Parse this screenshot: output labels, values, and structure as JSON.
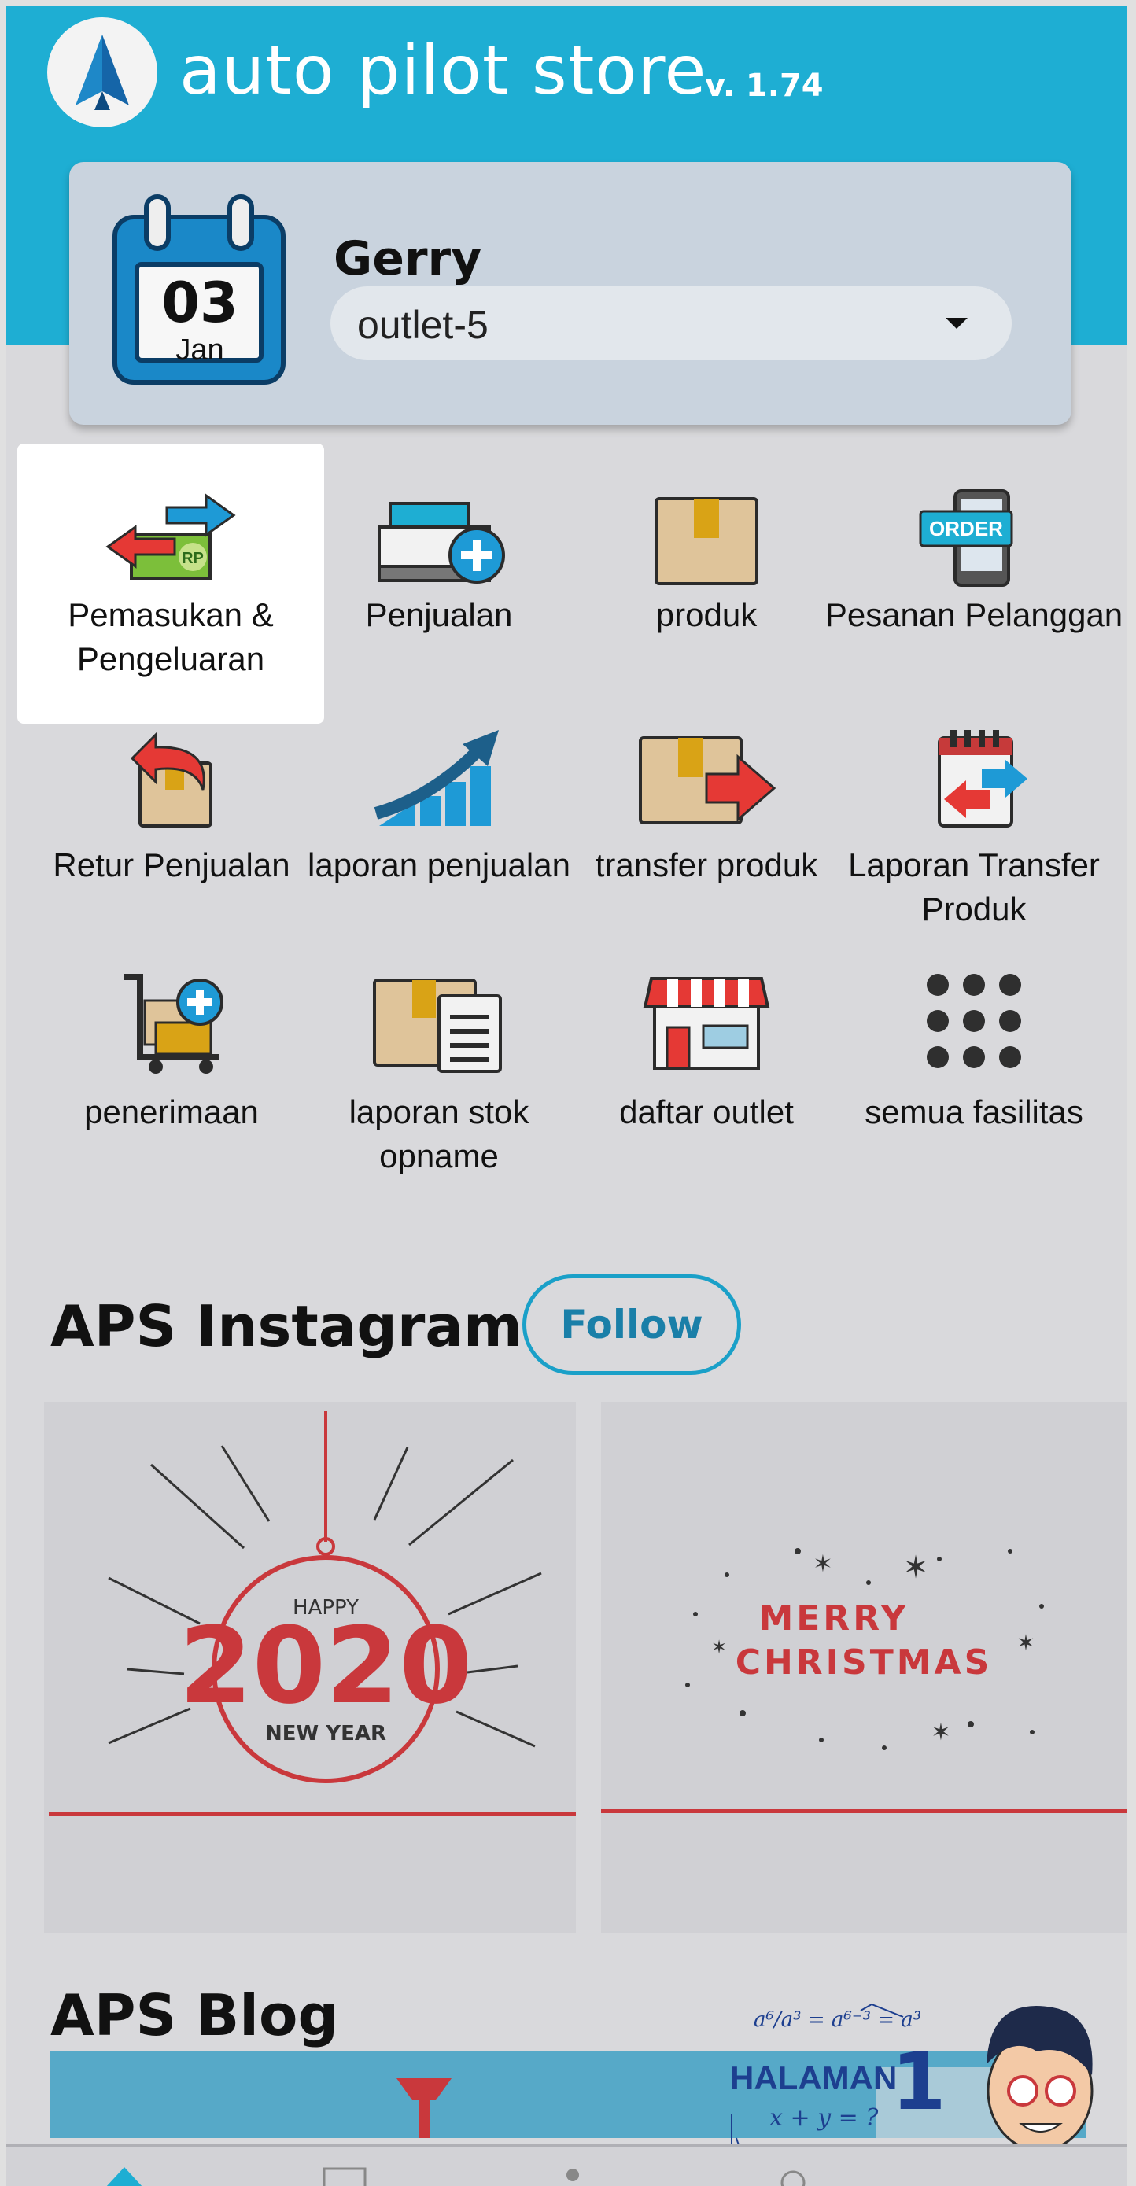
{
  "header": {
    "app_name": "auto pilot store",
    "version": "v. 1.74",
    "logo_icon": "paper-plane-logo-icon"
  },
  "user_card": {
    "calendar_day": "03",
    "calendar_month": "Jan",
    "user_name": "Gerry",
    "outlet_selected": "outlet-5"
  },
  "menu": {
    "items": [
      {
        "label": "Pemasukan & Pengeluaran",
        "icon": "money-exchange-icon",
        "active": true
      },
      {
        "label": "Penjualan",
        "icon": "cash-register-icon",
        "active": false
      },
      {
        "label": "produk",
        "icon": "box-icon",
        "active": false
      },
      {
        "label": "Pesanan Pelanggan",
        "icon": "order-tablet-icon",
        "active": false
      },
      {
        "label": "Retur Penjualan",
        "icon": "return-box-icon",
        "active": false
      },
      {
        "label": "laporan penjualan",
        "icon": "growth-chart-icon",
        "active": false
      },
      {
        "label": "transfer produk",
        "icon": "transfer-box-icon",
        "active": false
      },
      {
        "label": "Laporan Transfer Produk",
        "icon": "transfer-report-icon",
        "active": false
      },
      {
        "label": "penerimaan",
        "icon": "cart-receive-icon",
        "active": false
      },
      {
        "label": "laporan stok opname",
        "icon": "stock-report-icon",
        "active": false
      },
      {
        "label": "daftar outlet",
        "icon": "store-icon",
        "active": false
      },
      {
        "label": "semua fasilitas",
        "icon": "grid-dots-icon",
        "active": false
      }
    ]
  },
  "instagram": {
    "title": "APS Instagram",
    "follow_label": "Follow",
    "posts": [
      {
        "top_text": "HAPPY",
        "main_text": "2020",
        "bottom_text": "NEW YEAR"
      },
      {
        "line1": "MERRY",
        "line2": "CHRISTMAS"
      }
    ]
  },
  "blog": {
    "title": "APS Blog"
  },
  "overlay": {
    "label": "HALAMAN",
    "number": "1",
    "formula_top": "a⁶/a³ = a⁶⁻³ = a³",
    "formula_bottom": "x + y = ?"
  },
  "colors": {
    "header_bg": "#1eaed3",
    "card_bg": "#c9d3de",
    "follow_border": "#1aa0c8",
    "festive_red": "#c9383c"
  }
}
